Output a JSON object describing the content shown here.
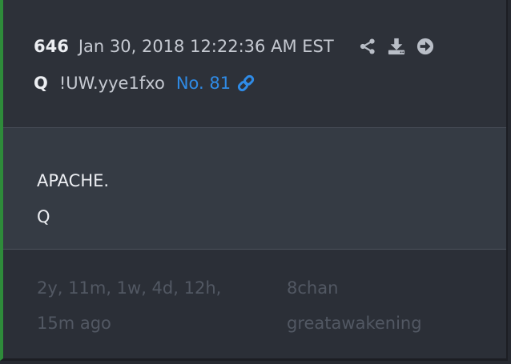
{
  "post": {
    "number": "646",
    "date": "Jan 30, 2018 12:22:36 AM EST",
    "author": "Q",
    "tripcode": "!UW.yye1fxo",
    "link_label": "No. 81",
    "message_lines": [
      "APACHE.",
      "Q"
    ]
  },
  "footer": {
    "age_lines": [
      "2y, 11m, 1w, 4d, 12h,",
      "15m ago"
    ],
    "source_lines": [
      "8chan",
      "greatawakening"
    ]
  },
  "icons": {
    "share": "share-icon",
    "download": "download-icon",
    "forward": "arrow-right-circle-icon",
    "link": "link-icon"
  },
  "colors": {
    "accent_link": "#2f8be6",
    "left_bar": "#2e8b3a",
    "icon": "#b9bec7"
  }
}
